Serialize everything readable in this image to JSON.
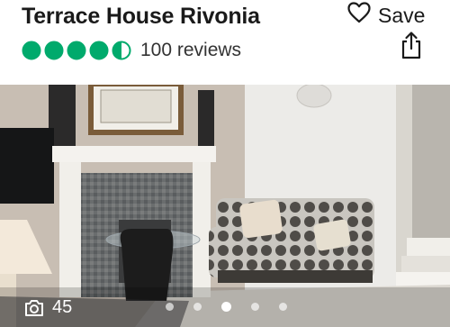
{
  "header": {
    "title": "Terrace House Rivonia",
    "save_label": "Save",
    "reviews_text": "100 reviews"
  },
  "rating": {
    "value": 4.5,
    "max": 5,
    "color": "#00aa6c"
  },
  "gallery": {
    "photo_count": "45",
    "total_dots": 5,
    "active_dot": 3
  },
  "icons": {
    "save": "heart-outline-icon",
    "share": "share-icon",
    "camera": "camera-icon"
  }
}
